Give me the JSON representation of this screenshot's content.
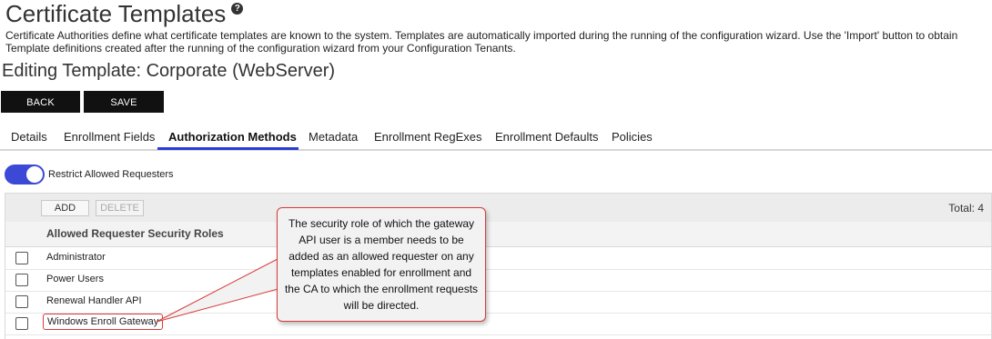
{
  "page": {
    "title": "Certificate Templates",
    "help_icon": "question-circle-icon",
    "description": "Certificate Authorities define what certificate templates are known to the system. Templates are automatically imported during the running of the configuration wizard. Use the 'Import' button to obtain Template definitions created after the running of the configuration wizard from your Configuration Tenants.",
    "subtitle": "Editing Template: Corporate (WebServer)"
  },
  "actions": {
    "back_label": "BACK",
    "save_label": "SAVE"
  },
  "tabs": [
    {
      "label": "Details",
      "active": false
    },
    {
      "label": "Enrollment Fields",
      "active": false
    },
    {
      "label": "Authorization Methods",
      "active": true
    },
    {
      "label": "Metadata",
      "active": false
    },
    {
      "label": "Enrollment RegExes",
      "active": false
    },
    {
      "label": "Enrollment Defaults",
      "active": false
    },
    {
      "label": "Policies",
      "active": false
    }
  ],
  "restrict_toggle": {
    "label": "Restrict Allowed Requesters",
    "on": true
  },
  "grid": {
    "add_label": "ADD",
    "delete_label": "DELETE",
    "total_label": "Total: 4",
    "column_header": "Allowed Requester Security Roles",
    "rows": [
      {
        "role": "Administrator",
        "checked": false
      },
      {
        "role": "Power Users",
        "checked": false
      },
      {
        "role": "Renewal Handler API",
        "checked": false
      },
      {
        "role": "Windows Enroll Gateway",
        "checked": false,
        "highlighted": true
      }
    ]
  },
  "callout": {
    "text": "The security role of which the gateway API user is a member needs to be added as an allowed requester on any templates enabled for enrollment and the CA to which the enrollment requests will be directed."
  },
  "colors": {
    "accent": "#2a3ed6",
    "toggle_on": "#3b49d6",
    "annotation_red": "#d83a3a",
    "button_dark": "#111111"
  }
}
